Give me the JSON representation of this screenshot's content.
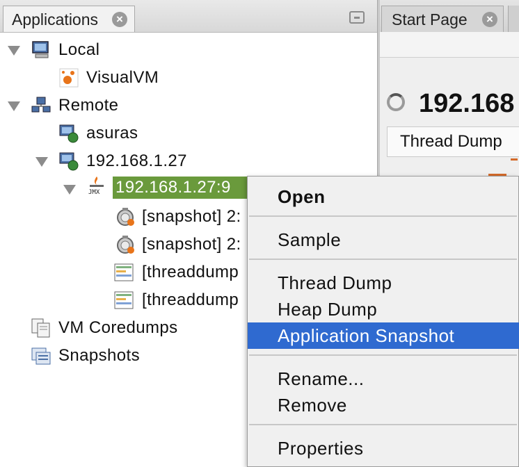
{
  "left_panel": {
    "tab_title": "Applications",
    "tab_close_glyph": "×"
  },
  "tree": {
    "local": "Local",
    "visualvm": "VisualVM",
    "remote": "Remote",
    "asuras": "asuras",
    "host": "192.168.1.27",
    "jmx_app": "192.168.1.27:9",
    "snapshot1": "[snapshot] 2:",
    "snapshot2": "[snapshot] 2:",
    "threaddump1": "[threaddump",
    "threaddump2": "[threaddump",
    "vm_coredumps": "VM Coredumps",
    "snapshots": "Snapshots"
  },
  "right_panel": {
    "start_tab": "Start Page",
    "tab_close_glyph": "×",
    "content_title": "192.168",
    "subtab_label": "Thread Dump"
  },
  "context_menu": {
    "open": "Open",
    "sample": "Sample",
    "thread_dump": "Thread Dump",
    "heap_dump": "Heap Dump",
    "application_snapshot": "Application Snapshot",
    "rename": "Rename...",
    "remove": "Remove",
    "properties": "Properties"
  },
  "colors": {
    "selection_green": "#6a9a3c",
    "menu_highlight": "#2f6ad0"
  },
  "icons": {
    "local": "computer-icon",
    "visualvm": "visualvm-icon",
    "remote": "network-icon",
    "remote_host": "remote-host-icon",
    "jmx": "jmx-icon",
    "snapshot": "snapshot-icon",
    "threaddump": "threaddump-icon",
    "coredumps": "coredumps-icon",
    "snapshots": "snapshots-icon"
  }
}
